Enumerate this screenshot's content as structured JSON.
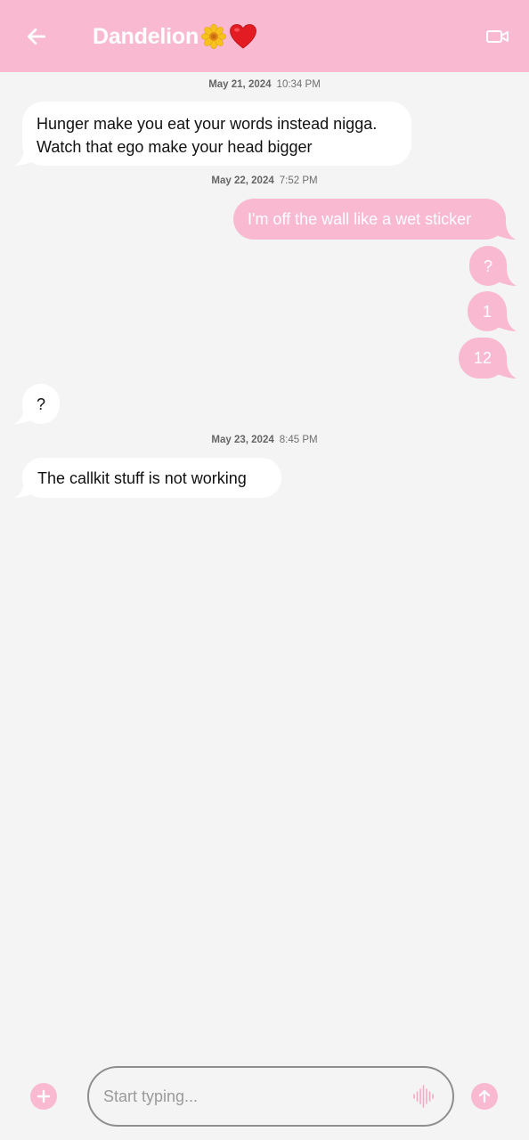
{
  "header": {
    "contact_name": "Dandelion",
    "title_emojis": [
      "flower-emoji",
      "red-heart-emoji"
    ],
    "back_icon": "arrow-left-icon",
    "video_icon": "video-call-icon",
    "background": "#f9bad1"
  },
  "messages": [
    {
      "type": "timestamp",
      "date": "May 21, 2024",
      "time": "10:34 PM"
    },
    {
      "type": "incoming",
      "text": "Hunger make you eat your words instead nigga. Watch that ego make your head bigger"
    },
    {
      "type": "timestamp",
      "date": "May 22, 2024",
      "time": "7:52 PM"
    },
    {
      "type": "outgoing",
      "text": "I'm off the wall like a wet sticker"
    },
    {
      "type": "outgoing",
      "text": "?"
    },
    {
      "type": "outgoing",
      "text": "1"
    },
    {
      "type": "outgoing",
      "text": "12"
    },
    {
      "type": "incoming",
      "text": "?"
    },
    {
      "type": "timestamp",
      "date": "May 23, 2024",
      "time": "8:45 PM"
    },
    {
      "type": "incoming",
      "text": "The callkit stuff is not working"
    }
  ],
  "composer": {
    "placeholder": "Start typing...",
    "value": "",
    "add_icon": "plus-icon",
    "voice_icon": "voice-waveform-icon",
    "send_icon": "arrow-up-icon"
  },
  "colors": {
    "accent": "#f9bad1",
    "background": "#f4f4f4",
    "incoming_bubble": "#ffffff",
    "incoming_text": "#111111",
    "outgoing_text": "#ffffff"
  }
}
